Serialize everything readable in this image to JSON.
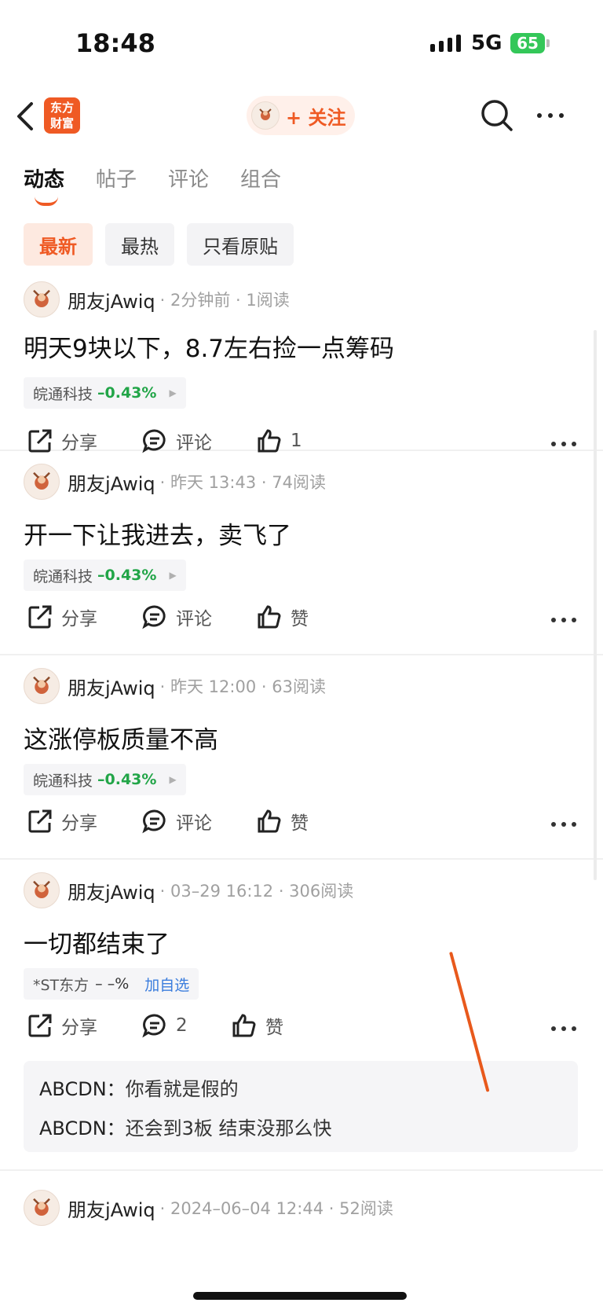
{
  "status_bar": {
    "time": "18:48",
    "network": "5G",
    "battery": "65"
  },
  "header": {
    "logo_line1": "东方",
    "logo_line2": "财富",
    "follow_label": "+ 关注",
    "icons": [
      "back-icon",
      "search-icon",
      "more-icon"
    ]
  },
  "tabs": [
    "动态",
    "帖子",
    "评论",
    "组合"
  ],
  "filters": [
    "最新",
    "最热",
    "只看原贴"
  ],
  "posts": [
    {
      "author": "朋友jAwiq",
      "meta": "· 2分钟前 · 1阅读",
      "text": "明天9块以下，8.7左右捡一点筹码",
      "stock": "皖通科技",
      "change": "–0.43%",
      "share": "分享",
      "comment": "评论",
      "like": "1"
    },
    {
      "author": "朋友jAwiq",
      "meta": "· 昨天 13:43 · 74阅读",
      "text": "开一下让我进去，卖飞了",
      "stock": "皖通科技",
      "change": "–0.43%",
      "share": "分享",
      "comment": "评论",
      "like": "赞"
    },
    {
      "author": "朋友jAwiq",
      "meta": "· 昨天 12:00 · 63阅读",
      "text": "这涨停板质量不高",
      "stock": "皖通科技",
      "change": "–0.43%",
      "share": "分享",
      "comment": "评论",
      "like": "赞"
    },
    {
      "author": "朋友jAwiq",
      "meta": "· 03–29 16:12 · 306阅读",
      "text": "一切都结束了",
      "stock": "*ST东方",
      "change": "– –%",
      "add": "加自选",
      "share": "分享",
      "comment": "2",
      "like": "赞",
      "replies": [
        {
          "user": "ABCDN：",
          "text": "你看就是假的"
        },
        {
          "user": "ABCDN：",
          "text": "还会到3板 结束没那么快"
        }
      ]
    },
    {
      "author": "朋友jAwiq",
      "meta": "· 2024–06–04 12:44 · 52阅读"
    }
  ],
  "colors": {
    "accent": "#ef5a24",
    "down_green": "#22a548",
    "link_blue": "#3b7ddd"
  }
}
